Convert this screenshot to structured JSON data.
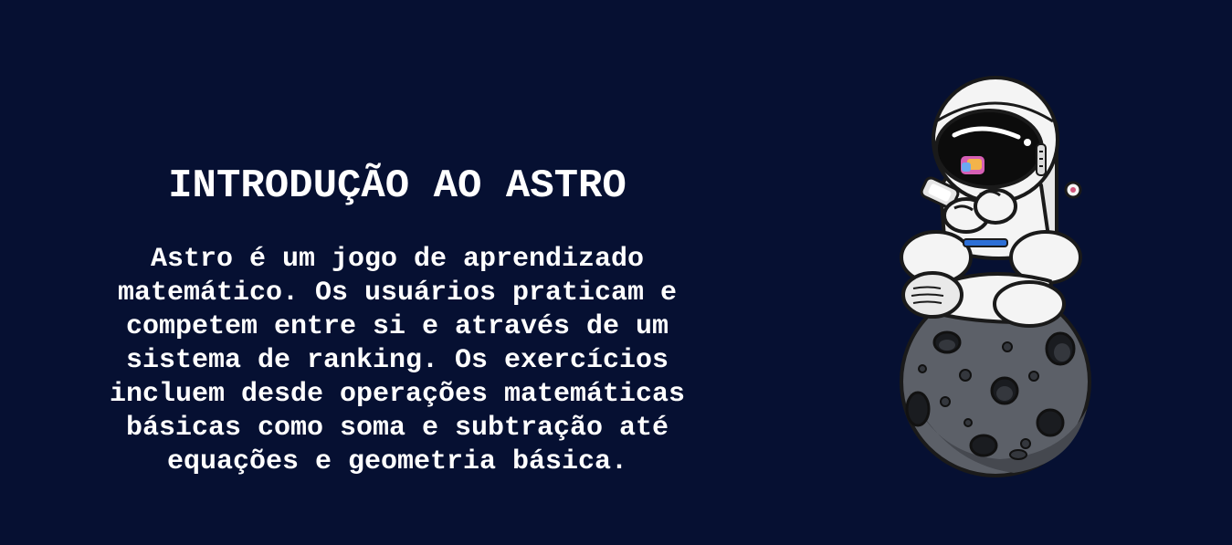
{
  "intro": {
    "title": "INTRODUÇÃO AO ASTRO",
    "description": "Astro é um jogo de aprendizado matemático. Os usuários praticam e competem entre si e através de um sistema de ranking. Os exercícios incluem desde operações matemáticas básicas como soma e subtração até equações e geometria básica."
  },
  "illustration": {
    "icon": "astronaut-on-moon-illustration"
  },
  "colors": {
    "background": "#061032",
    "text": "#ffffff",
    "moon": "#5c6068",
    "suit": "#f4f4f4"
  }
}
